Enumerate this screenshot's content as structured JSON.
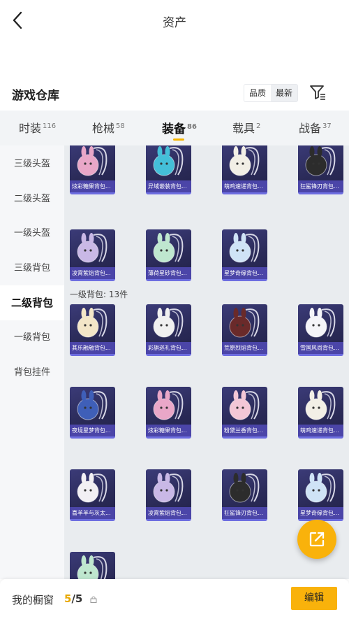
{
  "header": {
    "title": "资产"
  },
  "section": {
    "title": "游戏仓库",
    "sort_options": [
      "品质",
      "最新"
    ]
  },
  "tabs": [
    {
      "label": "时装",
      "count": "116"
    },
    {
      "label": "枪械",
      "count": "58"
    },
    {
      "label": "装备",
      "count": "86"
    },
    {
      "label": "载具",
      "count": "2"
    },
    {
      "label": "战备",
      "count": "37"
    }
  ],
  "sidebar": {
    "items": [
      "三级头盔",
      "二级头盔",
      "一级头盔",
      "三级背包",
      "二级背包",
      "一级背包",
      "背包挂件"
    ]
  },
  "groups": {
    "level1_backpack": "一级背包: 13件"
  },
  "cards": [
    {
      "label": "炫彩糖果背包...",
      "icon": "donut-backpack-icon",
      "color": "#e9a7c8"
    },
    {
      "label": "异域嵌装背包...",
      "icon": "tech-backpack-icon",
      "color": "#44bfd8"
    },
    {
      "label": "萌鸡速递背包...",
      "icon": "chick-backpack-icon",
      "color": "#f2efe6"
    },
    {
      "label": "狂鲨锋刃背包...",
      "icon": "shark-backpack-icon",
      "color": "#2c2c2c"
    },
    {
      "label": "凌霄紫焰背包...",
      "icon": "bunny-backpack-icon",
      "color": "#c9b8e6"
    },
    {
      "label": "薄荷星砂背包...",
      "icon": "mint-backpack-icon",
      "color": "#bfe7cf"
    },
    {
      "label": "星梦奇缘背包...",
      "icon": "swan-backpack-icon",
      "color": "#cfe3f6"
    },
    {
      "label": "其乐融融背包...",
      "icon": "cake-backpack-icon",
      "color": "#f3e6c8"
    },
    {
      "label": "彩旗巡礼背包...",
      "icon": "bunny-backpack-icon",
      "color": "#f0f0f0"
    },
    {
      "label": "荒原烈焰背包...",
      "icon": "fox-backpack-icon",
      "color": "#6a2a2a"
    },
    {
      "label": "雪国风尚背包...",
      "icon": "snow-backpack-icon",
      "color": "#f4f4f8"
    },
    {
      "label": "夜境星梦背包...",
      "icon": "space-backpack-icon",
      "color": "#3f5fb8"
    },
    {
      "label": "炫彩糖果背包...",
      "icon": "donut-backpack-icon",
      "color": "#e9a7c8"
    },
    {
      "label": "粉黛兰香背包...",
      "icon": "pink-bunny-backpack-icon",
      "color": "#f3c7d6"
    },
    {
      "label": "萌鸡速递背包...",
      "icon": "chick-backpack-icon",
      "color": "#f2efe6"
    },
    {
      "label": "喜羊羊与灰太...",
      "icon": "sheep-backpack-icon",
      "color": "#f2f0f4"
    },
    {
      "label": "凌霄紫焰背包...",
      "icon": "bunny-backpack-icon",
      "color": "#c9b8e6"
    },
    {
      "label": "狂鲨锋刃背包...",
      "icon": "shark-backpack-icon",
      "color": "#2c2c2c"
    },
    {
      "label": "星梦奇缘背包...",
      "icon": "swan-backpack-icon",
      "color": "#cfe3f6"
    },
    {
      "label": "",
      "icon": "mint-backpack-icon",
      "color": "#bfe7cf"
    }
  ],
  "bottom_bar": {
    "label": "我的橱窗",
    "current": "5",
    "total": "/5",
    "edit_label": "编辑"
  },
  "colors": {
    "accent": "#f9b20b",
    "card_bg": "#2e2e5e",
    "card_label_bg": "#4b45a8"
  }
}
